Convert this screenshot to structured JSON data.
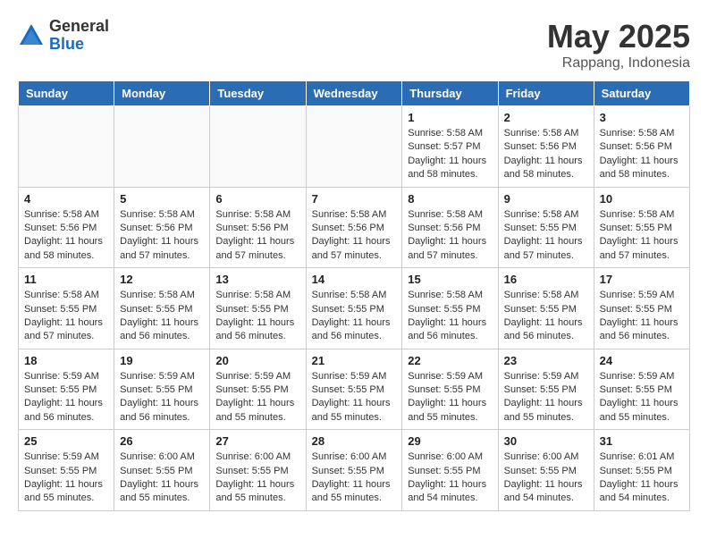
{
  "logo": {
    "general": "General",
    "blue": "Blue"
  },
  "title": "May 2025",
  "location": "Rappang, Indonesia",
  "days_header": [
    "Sunday",
    "Monday",
    "Tuesday",
    "Wednesday",
    "Thursday",
    "Friday",
    "Saturday"
  ],
  "weeks": [
    [
      {
        "day": "",
        "info": ""
      },
      {
        "day": "",
        "info": ""
      },
      {
        "day": "",
        "info": ""
      },
      {
        "day": "",
        "info": ""
      },
      {
        "day": "1",
        "info": "Sunrise: 5:58 AM\nSunset: 5:57 PM\nDaylight: 11 hours\nand 58 minutes."
      },
      {
        "day": "2",
        "info": "Sunrise: 5:58 AM\nSunset: 5:56 PM\nDaylight: 11 hours\nand 58 minutes."
      },
      {
        "day": "3",
        "info": "Sunrise: 5:58 AM\nSunset: 5:56 PM\nDaylight: 11 hours\nand 58 minutes."
      }
    ],
    [
      {
        "day": "4",
        "info": "Sunrise: 5:58 AM\nSunset: 5:56 PM\nDaylight: 11 hours\nand 58 minutes."
      },
      {
        "day": "5",
        "info": "Sunrise: 5:58 AM\nSunset: 5:56 PM\nDaylight: 11 hours\nand 57 minutes."
      },
      {
        "day": "6",
        "info": "Sunrise: 5:58 AM\nSunset: 5:56 PM\nDaylight: 11 hours\nand 57 minutes."
      },
      {
        "day": "7",
        "info": "Sunrise: 5:58 AM\nSunset: 5:56 PM\nDaylight: 11 hours\nand 57 minutes."
      },
      {
        "day": "8",
        "info": "Sunrise: 5:58 AM\nSunset: 5:56 PM\nDaylight: 11 hours\nand 57 minutes."
      },
      {
        "day": "9",
        "info": "Sunrise: 5:58 AM\nSunset: 5:55 PM\nDaylight: 11 hours\nand 57 minutes."
      },
      {
        "day": "10",
        "info": "Sunrise: 5:58 AM\nSunset: 5:55 PM\nDaylight: 11 hours\nand 57 minutes."
      }
    ],
    [
      {
        "day": "11",
        "info": "Sunrise: 5:58 AM\nSunset: 5:55 PM\nDaylight: 11 hours\nand 57 minutes."
      },
      {
        "day": "12",
        "info": "Sunrise: 5:58 AM\nSunset: 5:55 PM\nDaylight: 11 hours\nand 56 minutes."
      },
      {
        "day": "13",
        "info": "Sunrise: 5:58 AM\nSunset: 5:55 PM\nDaylight: 11 hours\nand 56 minutes."
      },
      {
        "day": "14",
        "info": "Sunrise: 5:58 AM\nSunset: 5:55 PM\nDaylight: 11 hours\nand 56 minutes."
      },
      {
        "day": "15",
        "info": "Sunrise: 5:58 AM\nSunset: 5:55 PM\nDaylight: 11 hours\nand 56 minutes."
      },
      {
        "day": "16",
        "info": "Sunrise: 5:58 AM\nSunset: 5:55 PM\nDaylight: 11 hours\nand 56 minutes."
      },
      {
        "day": "17",
        "info": "Sunrise: 5:59 AM\nSunset: 5:55 PM\nDaylight: 11 hours\nand 56 minutes."
      }
    ],
    [
      {
        "day": "18",
        "info": "Sunrise: 5:59 AM\nSunset: 5:55 PM\nDaylight: 11 hours\nand 56 minutes."
      },
      {
        "day": "19",
        "info": "Sunrise: 5:59 AM\nSunset: 5:55 PM\nDaylight: 11 hours\nand 56 minutes."
      },
      {
        "day": "20",
        "info": "Sunrise: 5:59 AM\nSunset: 5:55 PM\nDaylight: 11 hours\nand 55 minutes."
      },
      {
        "day": "21",
        "info": "Sunrise: 5:59 AM\nSunset: 5:55 PM\nDaylight: 11 hours\nand 55 minutes."
      },
      {
        "day": "22",
        "info": "Sunrise: 5:59 AM\nSunset: 5:55 PM\nDaylight: 11 hours\nand 55 minutes."
      },
      {
        "day": "23",
        "info": "Sunrise: 5:59 AM\nSunset: 5:55 PM\nDaylight: 11 hours\nand 55 minutes."
      },
      {
        "day": "24",
        "info": "Sunrise: 5:59 AM\nSunset: 5:55 PM\nDaylight: 11 hours\nand 55 minutes."
      }
    ],
    [
      {
        "day": "25",
        "info": "Sunrise: 5:59 AM\nSunset: 5:55 PM\nDaylight: 11 hours\nand 55 minutes."
      },
      {
        "day": "26",
        "info": "Sunrise: 6:00 AM\nSunset: 5:55 PM\nDaylight: 11 hours\nand 55 minutes."
      },
      {
        "day": "27",
        "info": "Sunrise: 6:00 AM\nSunset: 5:55 PM\nDaylight: 11 hours\nand 55 minutes."
      },
      {
        "day": "28",
        "info": "Sunrise: 6:00 AM\nSunset: 5:55 PM\nDaylight: 11 hours\nand 55 minutes."
      },
      {
        "day": "29",
        "info": "Sunrise: 6:00 AM\nSunset: 5:55 PM\nDaylight: 11 hours\nand 54 minutes."
      },
      {
        "day": "30",
        "info": "Sunrise: 6:00 AM\nSunset: 5:55 PM\nDaylight: 11 hours\nand 54 minutes."
      },
      {
        "day": "31",
        "info": "Sunrise: 6:01 AM\nSunset: 5:55 PM\nDaylight: 11 hours\nand 54 minutes."
      }
    ]
  ]
}
